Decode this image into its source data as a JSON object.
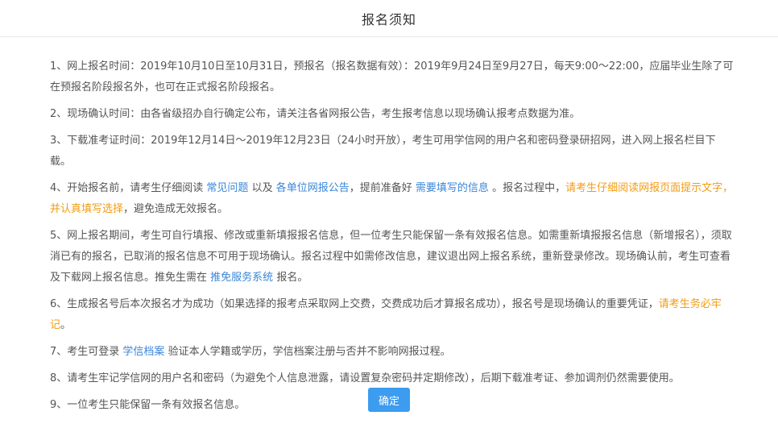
{
  "dialog": {
    "title": "报名须知",
    "confirm_label": "确定",
    "colors": {
      "link": "#3a86d8",
      "warning": "#f39c12",
      "button": "#3c9cf0"
    }
  },
  "notices": [
    {
      "text": "1、网上报名时间：2019年10月10日至10月31日，预报名（报名数据有效）：2019年9月24日至9月27日，每天9:00～22:00，应届毕业生除了可在预报名阶段报名外，也可在正式报名阶段报名。"
    },
    {
      "text": "2、现场确认时间：由各省级招办自行确定公布，请关注各省网报公告，考生报考信息以现场确认报考点数据为准。"
    },
    {
      "text": "3、下载准考证时间：2019年12月14日～2019年12月23日（24小时开放），考生可用学信网的用户名和密码登录研招网，进入网上报名栏目下载。"
    },
    {
      "pre": "4、开始报名前，请考生仔细阅读",
      "link1": "常见问题",
      "mid1": "以及",
      "link2": "各单位网报公告",
      "mid2": "，提前准备好",
      "link3": "需要填写的信息",
      "mid3": "。报名过程中，",
      "warn": "请考生仔细阅读网报页面提示文字，并认真填写选择",
      "post": "，避免造成无效报名。"
    },
    {
      "pre": "5、网上报名期间，考生可自行填报、修改或重新填报报名信息，但一位考生只能保留一条有效报名信息。如需重新填报报名信息（新增报名），须取消已有的报名，已取消的报名信息不可用于现场确认。报名过程中如需修改信息，建议退出网上报名系统，重新登录修改。现场确认前，考生可查看及下载网上报名信息。推免生需在",
      "link": "推免服务系统",
      "post": "报名。"
    },
    {
      "pre": "6、生成报名号后本次报名才为成功（如果选择的报考点采取网上交费，交费成功后才算报名成功），报名号是现场确认的重要凭证，",
      "warn": "请考生务必牢记",
      "post": "。"
    },
    {
      "pre": "7、考生可登录",
      "link": "学信档案",
      "post": "验证本人学籍或学历，学信档案注册与否并不影响网报过程。"
    },
    {
      "text": "8、请考生牢记学信网的用户名和密码（为避免个人信息泄露，请设置复杂密码并定期修改），后期下载准考证、参加调剂仍然需要使用。"
    },
    {
      "text": "9、一位考生只能保留一条有效报名信息。"
    }
  ]
}
